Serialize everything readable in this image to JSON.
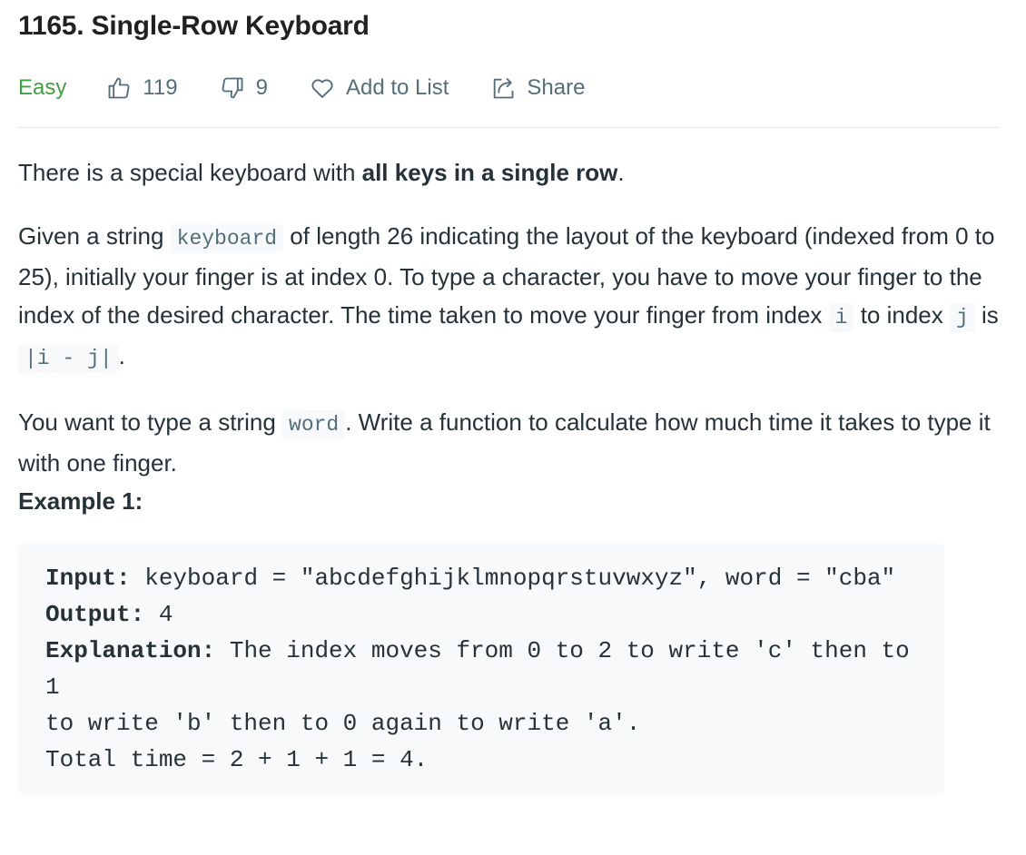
{
  "problem": {
    "title": "1165. Single-Row Keyboard",
    "difficulty": "Easy",
    "likes": "119",
    "dislikes": "9",
    "add_to_list": "Add to List",
    "share": "Share"
  },
  "description": {
    "p1": {
      "before": "There is a special keyboard with ",
      "bold": "all keys in a single row",
      "after": "."
    },
    "p2": {
      "t1": "Given a string ",
      "code1": "keyboard",
      "t2": " of length 26 indicating the layout of the keyboard (indexed from 0 to 25), initially your finger is at index 0. To type a character, you have to move your finger to the index of the desired character. The time taken to move your finger from index ",
      "code2": "i",
      "t3": " to index ",
      "code3": "j",
      "t4": " is ",
      "code4": "|i - j|",
      "t5": "."
    },
    "p3": {
      "t1": "You want to type a string ",
      "code1": "word",
      "t2": ". Write a function to calculate how much time it takes to type it with one finger."
    }
  },
  "example": {
    "heading": "Example 1:",
    "input_label": "Input:",
    "input_value": " keyboard = \"abcdefghijklmnopqrstuvwxyz\", word = \"cba\"",
    "output_label": "Output:",
    "output_value": " 4",
    "explanation_label": "Explanation:",
    "explanation_value": " The index moves from 0 to 2 to write 'c' then to 1\nto write 'b' then to 0 again to write 'a'.",
    "total": "Total time = 2 + 1 + 1 = 4."
  },
  "colors": {
    "easy": "#43a047",
    "meta": "#546e7a",
    "text": "#263238",
    "code_bg": "#f7f9fa"
  },
  "icons": {
    "likes": "thumbs-up-icon",
    "dislikes": "thumbs-down-icon",
    "add_to_list": "heart-icon",
    "share": "share-icon"
  }
}
